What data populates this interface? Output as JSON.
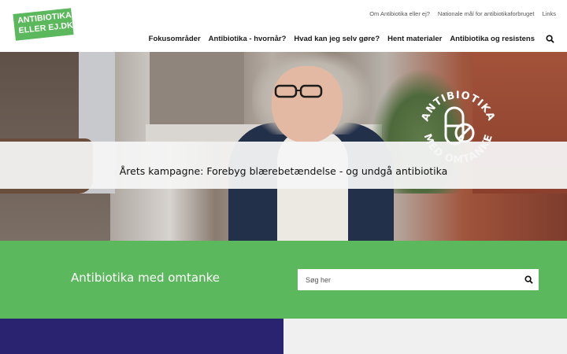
{
  "header": {
    "logo": {
      "line1": "ANTIBIOTIKA",
      "line2": "ELLER EJ.DK"
    },
    "utility_nav": [
      "Om Antibiotika eller ej?",
      "Nationale mål for antibiotikaforbruget",
      "Links"
    ],
    "main_nav": [
      "Fokusområder",
      "Antibiotika - hvornår?",
      "Hvad kan jeg selv gøre?",
      "Hent materialer",
      "Antibiotika og resistens"
    ],
    "search_icon": "search-icon"
  },
  "hero": {
    "stamp_top": "ANTIBIOTIKA",
    "stamp_bottom": "MED OMTANKE",
    "campaign_text": "Årets kampagne: Forebyg blærebetændelse - og undgå antibiotika"
  },
  "green_section": {
    "title": "Antibiotika med omtanke",
    "search_placeholder": "Søg her",
    "search_icon": "search-icon"
  },
  "colors": {
    "brand_green": "#5cb85c",
    "navy": "#2a2470",
    "light_gray": "#f0f0f0"
  }
}
